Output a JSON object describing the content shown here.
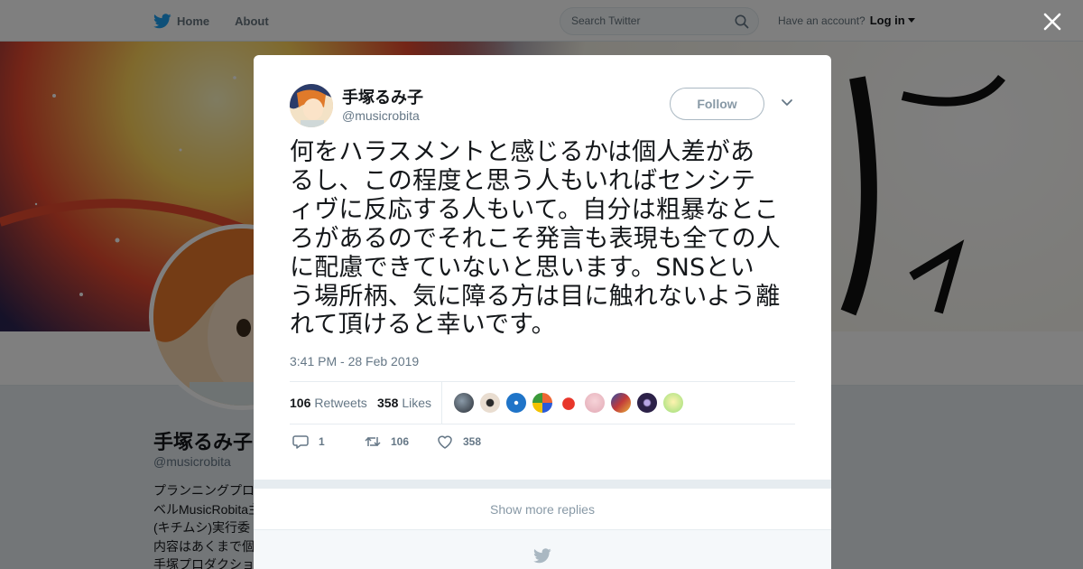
{
  "nav": {
    "home_label": "Home",
    "about_label": "About",
    "search_placeholder": "Search Twitter",
    "account_prompt": "Have an account?",
    "login_label": "Log in"
  },
  "profile": {
    "name": "手塚るみ子",
    "handle": "@musicrobita",
    "bio_lines": [
      "プランニングプロ",
      "ベルMusicRobita主",
      "(キチムシ)実行委",
      "内容はあくまで個",
      "手塚プロダクショ"
    ]
  },
  "tweet": {
    "author_name": "手塚るみ子",
    "author_handle": "@musicrobita",
    "follow_label": "Follow",
    "text_lines": [
      "何をハラスメントと感じるかは個人差があ",
      "るし、この程度と思う人もいればセンシテ",
      "ィヴに反応する人もいて。自分は粗暴なとこ",
      "ろがあるのでそれこそ発言も表現も全ての人",
      "に配慮できていないと思います。SNSとい",
      "う場所柄、気に障る方は目に触れないよう離",
      "れて頂けると幸いです。"
    ],
    "timestamp": "3:41 PM - 28 Feb 2019",
    "retweets_count": "106",
    "retweets_label": "Retweets",
    "likes_count": "358",
    "likes_label": "Likes",
    "reply_count": "1",
    "retweet_action_count": "106",
    "like_action_count": "358"
  },
  "show_more_label": "Show more replies",
  "colors": {
    "accent": "#1da1f2",
    "muted": "#657786",
    "border": "#e6ecf0"
  }
}
